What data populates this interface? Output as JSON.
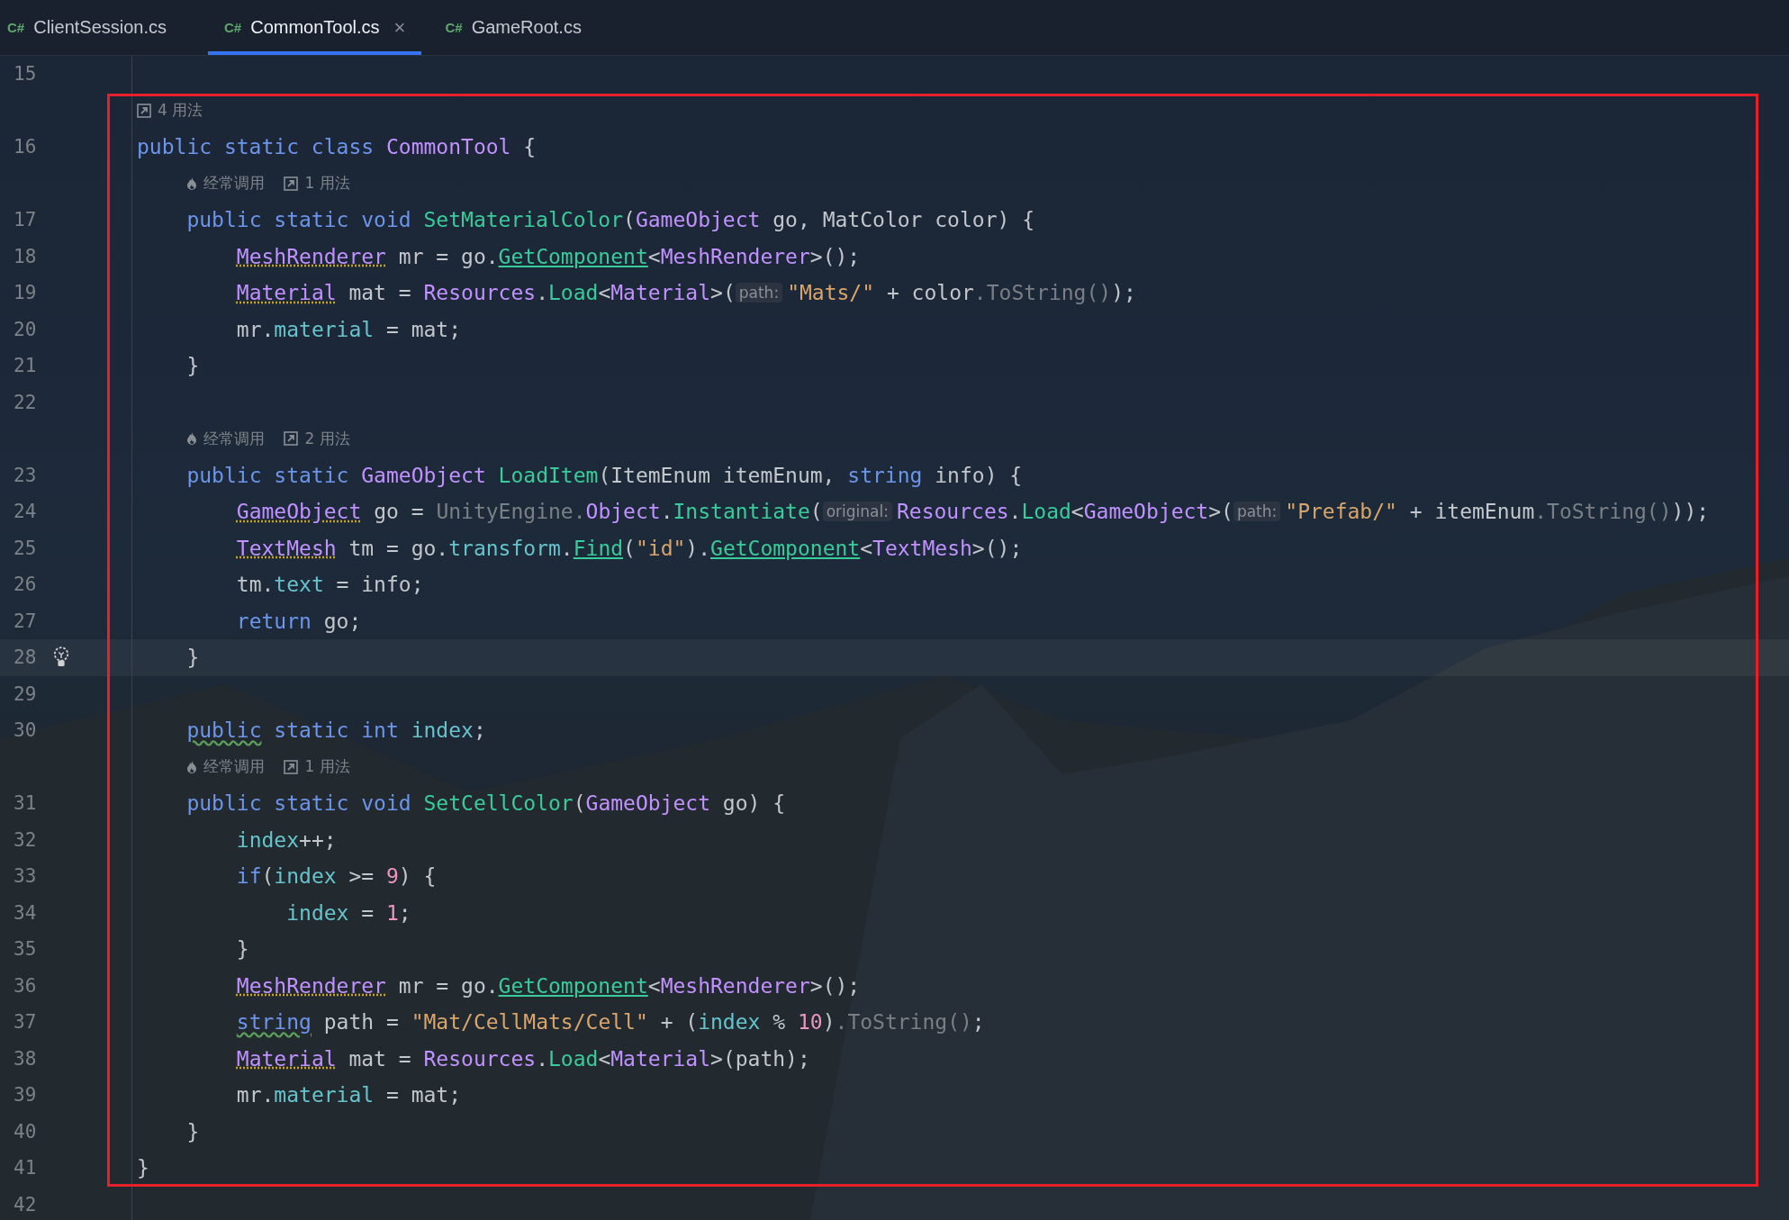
{
  "tabs": [
    {
      "lang": "C#",
      "label": "ClientSession.cs",
      "selected": false
    },
    {
      "lang": "C#",
      "label": "CommonTool.cs",
      "selected": true,
      "close": "×"
    },
    {
      "lang": "C#",
      "label": "GameRoot.cs",
      "selected": false
    }
  ],
  "annotation": {
    "kind": "rectangle",
    "color": "#e8202a"
  },
  "lines": [
    {
      "kind": "code",
      "number": "15"
    },
    {
      "kind": "hint",
      "usages": "4 用法"
    },
    {
      "kind": "code",
      "number": "16",
      "tokens": [
        {
          "kind": "kw",
          "s": "public static class "
        },
        {
          "kind": "type",
          "s": "CommonTool"
        },
        {
          "kind": "text",
          "s": " {"
        }
      ],
      "children": [
        {
          "kind": "hint",
          "frequent": "经常调用",
          "usages": "1 用法"
        },
        {
          "kind": "code",
          "number": "17",
          "tokens": [
            {
              "kind": "kw",
              "s": "public static void "
            },
            {
              "kind": "method",
              "s": "SetMaterialColor"
            },
            {
              "kind": "text",
              "s": "("
            },
            {
              "kind": "type",
              "s": "GameObject"
            },
            {
              "kind": "text",
              "s": " go, MatColor color) {"
            }
          ],
          "children": [
            {
              "kind": "code",
              "number": "18",
              "tokens": [
                {
                  "kind": "typeu",
                  "s": "MeshRenderer"
                },
                {
                  "kind": "text",
                  "s": " mr = go."
                },
                {
                  "kind": "call",
                  "s": "GetComponent"
                },
                {
                  "kind": "text",
                  "s": "<"
                },
                {
                  "kind": "type",
                  "s": "MeshRenderer"
                },
                {
                  "kind": "text",
                  "s": ">();"
                }
              ]
            },
            {
              "kind": "code",
              "number": "19",
              "tokens": [
                {
                  "kind": "typeu",
                  "s": "Material"
                },
                {
                  "kind": "text",
                  "s": " mat = "
                },
                {
                  "kind": "type",
                  "s": "Resources"
                },
                {
                  "kind": "text",
                  "s": "."
                },
                {
                  "kind": "method",
                  "s": "Load"
                },
                {
                  "kind": "text",
                  "s": "<"
                },
                {
                  "kind": "type",
                  "s": "Material"
                },
                {
                  "kind": "text",
                  "s": ">("
                },
                {
                  "kind": "inlay",
                  "s": "path:"
                },
                {
                  "kind": "str",
                  "s": "\"Mats/\""
                },
                {
                  "kind": "text",
                  "s": " + color"
                },
                {
                  "kind": "dim",
                  "s": ".ToString()"
                },
                {
                  "kind": "text",
                  "s": ");"
                }
              ]
            },
            {
              "kind": "code",
              "number": "20",
              "tokens": [
                {
                  "kind": "text",
                  "s": "mr."
                },
                {
                  "kind": "field",
                  "s": "material"
                },
                {
                  "kind": "text",
                  "s": " = mat;"
                }
              ]
            }
          ]
        },
        {
          "kind": "code",
          "number": "21",
          "tokens": [
            {
              "kind": "text",
              "s": "}"
            }
          ]
        },
        {
          "kind": "code",
          "number": "22"
        },
        {
          "kind": "hint",
          "frequent": "经常调用",
          "usages": "2 用法"
        },
        {
          "kind": "code",
          "number": "23",
          "tokens": [
            {
              "kind": "kw",
              "s": "public static "
            },
            {
              "kind": "type",
              "s": "GameObject"
            },
            {
              "kind": "method",
              "s": " LoadItem"
            },
            {
              "kind": "text",
              "s": "(ItemEnum itemEnum, "
            },
            {
              "kind": "kw",
              "s": "string"
            },
            {
              "kind": "text",
              "s": " info) {"
            }
          ],
          "children": [
            {
              "kind": "code",
              "number": "24",
              "tokens": [
                {
                  "kind": "typeu",
                  "s": "GameObject"
                },
                {
                  "kind": "text",
                  "s": " go = "
                },
                {
                  "kind": "dim",
                  "s": "UnityEngine."
                },
                {
                  "kind": "type",
                  "s": "Object"
                },
                {
                  "kind": "text",
                  "s": "."
                },
                {
                  "kind": "method",
                  "s": "Instantiate"
                },
                {
                  "kind": "text",
                  "s": "("
                },
                {
                  "kind": "inlay",
                  "s": "original:"
                },
                {
                  "kind": "type",
                  "s": "Resources"
                },
                {
                  "kind": "text",
                  "s": "."
                },
                {
                  "kind": "method",
                  "s": "Load"
                },
                {
                  "kind": "text",
                  "s": "<"
                },
                {
                  "kind": "type",
                  "s": "GameObject"
                },
                {
                  "kind": "text",
                  "s": ">("
                },
                {
                  "kind": "inlay",
                  "s": "path:"
                },
                {
                  "kind": "str",
                  "s": "\"Prefab/\""
                },
                {
                  "kind": "text",
                  "s": " + itemEnum"
                },
                {
                  "kind": "dim",
                  "s": ".ToString()"
                },
                {
                  "kind": "text",
                  "s": "));"
                }
              ]
            },
            {
              "kind": "code",
              "number": "25",
              "tokens": [
                {
                  "kind": "typeu",
                  "s": "TextMesh"
                },
                {
                  "kind": "text",
                  "s": " tm = go."
                },
                {
                  "kind": "field",
                  "s": "transform"
                },
                {
                  "kind": "text",
                  "s": "."
                },
                {
                  "kind": "call",
                  "s": "Find"
                },
                {
                  "kind": "text",
                  "s": "("
                },
                {
                  "kind": "str",
                  "s": "\"id\""
                },
                {
                  "kind": "text",
                  "s": ")."
                },
                {
                  "kind": "call",
                  "s": "GetComponent"
                },
                {
                  "kind": "text",
                  "s": "<"
                },
                {
                  "kind": "type",
                  "s": "TextMesh"
                },
                {
                  "kind": "text",
                  "s": ">();"
                }
              ]
            },
            {
              "kind": "code",
              "number": "26",
              "tokens": [
                {
                  "kind": "text",
                  "s": "tm."
                },
                {
                  "kind": "field",
                  "s": "text"
                },
                {
                  "kind": "text",
                  "s": " = info;"
                }
              ]
            },
            {
              "kind": "code",
              "number": "27",
              "tokens": [
                {
                  "kind": "kw",
                  "s": "return"
                },
                {
                  "kind": "text",
                  "s": " go;"
                }
              ]
            }
          ]
        },
        {
          "kind": "code",
          "number": "28",
          "current": true,
          "bulb": true,
          "tokens": [
            {
              "kind": "text",
              "s": "}"
            }
          ]
        },
        {
          "kind": "code",
          "number": "29"
        },
        {
          "kind": "code",
          "number": "30",
          "tokens": [
            {
              "kind": "kwu",
              "s": "public"
            },
            {
              "kind": "kw",
              "s": " static int "
            },
            {
              "kind": "field",
              "s": "index"
            },
            {
              "kind": "text",
              "s": ";"
            }
          ]
        },
        {
          "kind": "hint",
          "frequent": "经常调用",
          "usages": "1 用法"
        },
        {
          "kind": "code",
          "number": "31",
          "tokens": [
            {
              "kind": "kw",
              "s": "public static void "
            },
            {
              "kind": "method",
              "s": "SetCellColor"
            },
            {
              "kind": "text",
              "s": "("
            },
            {
              "kind": "type",
              "s": "GameObject"
            },
            {
              "kind": "text",
              "s": " go) {"
            }
          ],
          "children": [
            {
              "kind": "code",
              "number": "32",
              "tokens": [
                {
                  "kind": "field",
                  "s": "index"
                },
                {
                  "kind": "text",
                  "s": "++;"
                }
              ]
            },
            {
              "kind": "code",
              "number": "33",
              "tokens": [
                {
                  "kind": "kw",
                  "s": "if"
                },
                {
                  "kind": "text",
                  "s": "("
                },
                {
                  "kind": "field",
                  "s": "index"
                },
                {
                  "kind": "text",
                  "s": " >= "
                },
                {
                  "kind": "num",
                  "s": "9"
                },
                {
                  "kind": "text",
                  "s": ") {"
                }
              ],
              "children": [
                {
                  "kind": "code",
                  "number": "34",
                  "tokens": [
                    {
                      "kind": "field",
                      "s": "index"
                    },
                    {
                      "kind": "text",
                      "s": " = "
                    },
                    {
                      "kind": "num",
                      "s": "1"
                    },
                    {
                      "kind": "text",
                      "s": ";"
                    }
                  ]
                }
              ]
            },
            {
              "kind": "code",
              "number": "35",
              "tokens": [
                {
                  "kind": "text",
                  "s": "}"
                }
              ]
            },
            {
              "kind": "code",
              "number": "36",
              "tokens": [
                {
                  "kind": "typeu",
                  "s": "MeshRenderer"
                },
                {
                  "kind": "text",
                  "s": " mr = go."
                },
                {
                  "kind": "call",
                  "s": "GetComponent"
                },
                {
                  "kind": "text",
                  "s": "<"
                },
                {
                  "kind": "type",
                  "s": "MeshRenderer"
                },
                {
                  "kind": "text",
                  "s": ">();"
                }
              ]
            },
            {
              "kind": "code",
              "number": "37",
              "tokens": [
                {
                  "kind": "kwu",
                  "s": "string"
                },
                {
                  "kind": "text",
                  "s": " path = "
                },
                {
                  "kind": "str",
                  "s": "\"Mat/CellMats/Cell\""
                },
                {
                  "kind": "text",
                  "s": " + ("
                },
                {
                  "kind": "field",
                  "s": "index"
                },
                {
                  "kind": "text",
                  "s": " % "
                },
                {
                  "kind": "num",
                  "s": "10"
                },
                {
                  "kind": "text",
                  "s": ")"
                },
                {
                  "kind": "dim",
                  "s": ".ToString()"
                },
                {
                  "kind": "text",
                  "s": ";"
                }
              ]
            },
            {
              "kind": "code",
              "number": "38",
              "tokens": [
                {
                  "kind": "typeu",
                  "s": "Material"
                },
                {
                  "kind": "text",
                  "s": " mat = "
                },
                {
                  "kind": "type",
                  "s": "Resources"
                },
                {
                  "kind": "text",
                  "s": "."
                },
                {
                  "kind": "method",
                  "s": "Load"
                },
                {
                  "kind": "text",
                  "s": "<"
                },
                {
                  "kind": "type",
                  "s": "Material"
                },
                {
                  "kind": "text",
                  "s": ">(path);"
                }
              ]
            },
            {
              "kind": "code",
              "number": "39",
              "tokens": [
                {
                  "kind": "text",
                  "s": "mr."
                },
                {
                  "kind": "field",
                  "s": "material"
                },
                {
                  "kind": "text",
                  "s": " = mat;"
                }
              ]
            }
          ]
        },
        {
          "kind": "code",
          "number": "40",
          "tokens": [
            {
              "kind": "text",
              "s": "}"
            }
          ]
        }
      ]
    },
    {
      "kind": "code",
      "number": "41",
      "tokens": [
        {
          "kind": "text",
          "s": "}"
        }
      ]
    },
    {
      "kind": "code",
      "number": "42"
    }
  ]
}
